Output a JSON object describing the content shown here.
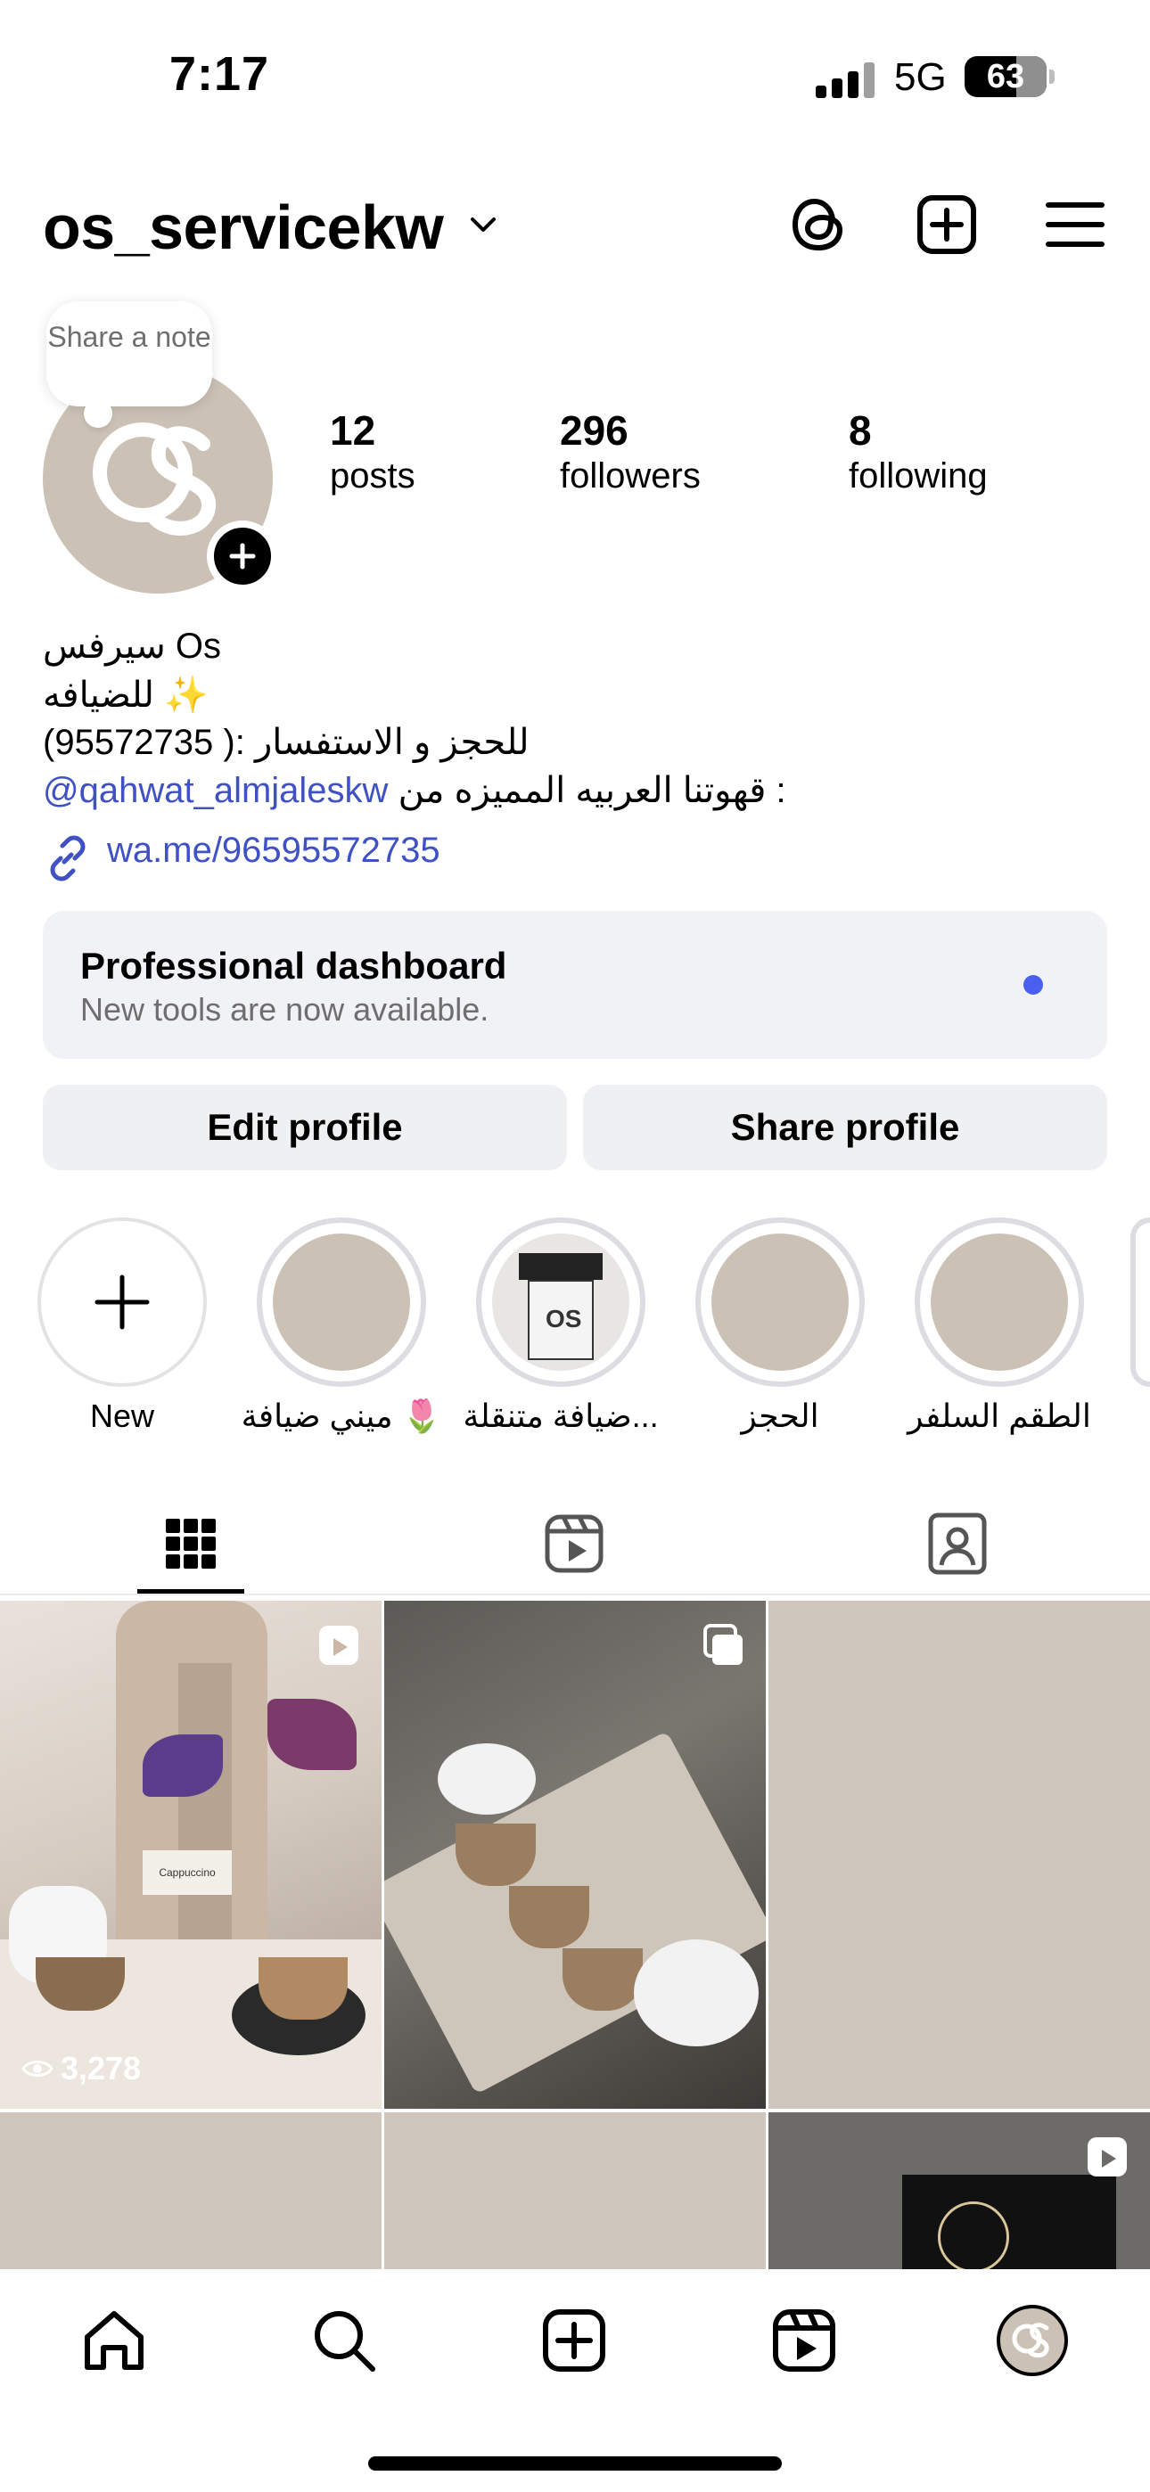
{
  "status_bar": {
    "time": "7:17",
    "network": "5G",
    "battery": "63"
  },
  "header": {
    "username": "os_servicekw"
  },
  "note": {
    "text": "Share a note"
  },
  "stats": {
    "posts": {
      "count": "12",
      "label": "posts"
    },
    "followers": {
      "count": "296",
      "label": "followers"
    },
    "following": {
      "count": "8",
      "label": "following"
    }
  },
  "bio": {
    "name": "سيرفس Os",
    "line2": "للضيافه ✨",
    "line3": "للحجز و الاستفسار :( 95572735)",
    "line4_text": "قهوتنا العربيه المميزه من :",
    "line4_mention": "@qahwat_almjaleskw",
    "link": "wa.me/96595572735"
  },
  "dashboard": {
    "title": "Professional dashboard",
    "subtitle": "New tools are now available."
  },
  "buttons": {
    "edit": "Edit profile",
    "share": "Share profile"
  },
  "highlights": [
    {
      "label": "New"
    },
    {
      "label": "ميني ضيافة 🌷"
    },
    {
      "label": "ضيافة متنقلة..."
    },
    {
      "label": "الحجز"
    },
    {
      "label": "الطقم السلفر"
    }
  ],
  "grid": {
    "views_first": "3,278"
  },
  "icons": {
    "threads": "threads-icon",
    "add": "add-post-icon",
    "menu": "menu-icon",
    "grid_tab": "grid-icon",
    "reels_tab": "reels-icon",
    "tagged_tab": "tagged-icon",
    "home": "home-icon",
    "search": "search-icon",
    "create": "create-icon",
    "reels": "reels-icon",
    "profile": "profile-avatar"
  },
  "colors": {
    "link": "#3f51c5",
    "dot": "#4a5ff0",
    "avatar_bg": "#cbc1b5",
    "card_bg": "#f1f2f5"
  }
}
